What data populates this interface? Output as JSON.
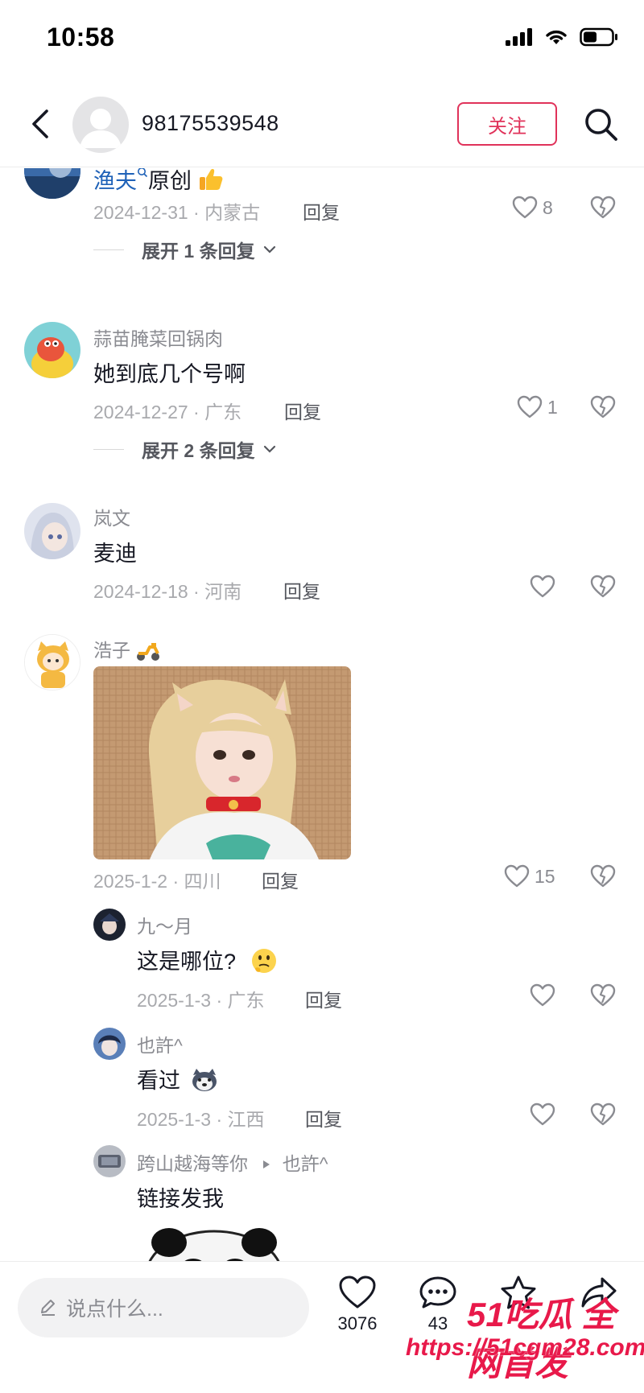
{
  "status_bar": {
    "time": "10:58"
  },
  "header": {
    "username": "98175539548",
    "follow_label": "关注"
  },
  "comments": [
    {
      "text_name": "渔夫",
      "text": "原创",
      "date_location": "2024-12-31 · 内蒙古",
      "reply_label": "回复",
      "likes": "8",
      "expand_label": "展开 1 条回复"
    },
    {
      "username": "蒜苗腌菜回锅肉",
      "text": "她到底几个号啊",
      "date_location": "2024-12-27 · 广东",
      "reply_label": "回复",
      "likes": "1",
      "expand_label": "展开 2 条回复"
    },
    {
      "username": "岚文",
      "text": "麦迪",
      "date_location": "2024-12-18 · 河南",
      "reply_label": "回复"
    },
    {
      "username": "浩子",
      "date_location": "2025-1-2 · 四川",
      "reply_label": "回复",
      "likes": "15"
    }
  ],
  "replies": [
    {
      "username": "九～月",
      "text": "这是哪位?",
      "date_location": "2025-1-3 · 广东",
      "reply_label": "回复"
    },
    {
      "username": "也許^",
      "text": "看过",
      "date_location": "2025-1-3 · 江西",
      "reply_label": "回复"
    },
    {
      "username": "跨山越海等你",
      "reply_to": "也許^",
      "text": "链接发我"
    }
  ],
  "bottom_bar": {
    "input_placeholder": "说点什么...",
    "like_count": "3076",
    "comment_count": "43"
  },
  "watermark": {
    "logo": "51吃瓜 全网首发",
    "url": "https://51cgm28.com"
  },
  "colors": {
    "accent": "#e0325a",
    "text_primary": "#161823",
    "text_secondary": "#8a8b91",
    "link_blue": "#1f62b8"
  }
}
